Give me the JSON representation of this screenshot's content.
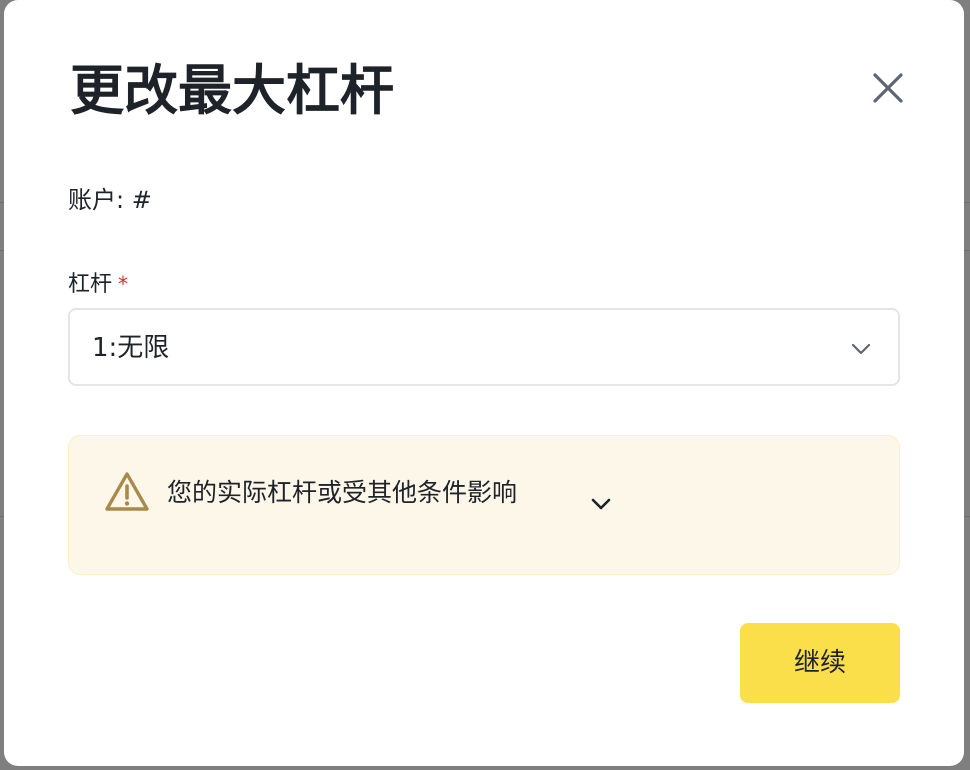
{
  "dialog": {
    "title": "更改最大杠杆",
    "close_icon": "close-icon"
  },
  "account": {
    "text": "账户: #"
  },
  "leverage": {
    "label": "杠杆",
    "required_mark": "*",
    "selected_value": "1:无限",
    "dropdown_icon": "chevron-down-icon"
  },
  "notice": {
    "icon": "warning-triangle-icon",
    "text": "您的实际杠杆或受其他条件影响",
    "expand_icon": "chevron-down-icon",
    "background_color": "#fdf7ea",
    "icon_color": "#a98a4a"
  },
  "actions": {
    "continue_label": "继续",
    "accent_color": "#fadf4b"
  }
}
